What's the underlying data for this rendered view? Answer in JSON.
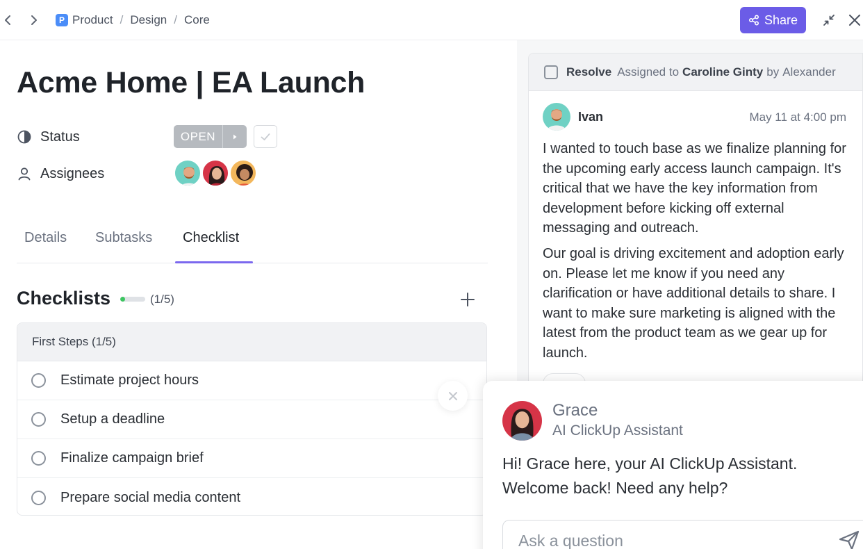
{
  "breadcrumb": {
    "space_badge": "P",
    "items": [
      "Product",
      "Design",
      "Core"
    ],
    "separator": "/"
  },
  "header": {
    "share_label": "Share"
  },
  "task": {
    "title": "Acme Home | EA Launch",
    "status_label": "Status",
    "status_value": "OPEN",
    "assignees_label": "Assignees"
  },
  "tabs": [
    {
      "label": "Details",
      "active": false
    },
    {
      "label": "Subtasks",
      "active": false
    },
    {
      "label": "Checklist",
      "active": true
    }
  ],
  "checklists": {
    "title": "Checklists",
    "progress_text": "(1/5)",
    "progress_fraction": 0.2,
    "group_title": "First Steps (1/5)",
    "items": [
      "Estimate project hours",
      "Setup a deadline",
      "Finalize campaign brief",
      "Prepare social media content"
    ]
  },
  "comment": {
    "resolve_label": "Resolve",
    "assigned_prefix": "Assigned to",
    "assignee": "Caroline Ginty",
    "by_prefix": "by",
    "assigner": "Alexander",
    "author": "Ivan",
    "timestamp": "May 11 at 4:00 pm",
    "paragraphs": [
      "I wanted to touch base as we finalize planning for the upcoming early access launch campaign. It's critical that we have the key information from development before kicking off external messaging and outreach.",
      "Our goal is driving excitement and adoption early on. Please let me know if you need any clarification or have additional details to share. I want to make sure marketing is aligned with the latest from the product team as we gear up for launch."
    ]
  },
  "assistant": {
    "name": "Grace",
    "role": "AI ClickUp Assistant",
    "message": "Hi! Grace here, your AI ClickUp Assistant. Welcome back! Need any help?",
    "input_placeholder": "Ask a question"
  },
  "colors": {
    "accent": "#7b68ee",
    "share_button": "#6b5ce7",
    "status_open": "#b6babf",
    "progress_green": "#3dc561",
    "space_badge": "#4b8df8"
  }
}
